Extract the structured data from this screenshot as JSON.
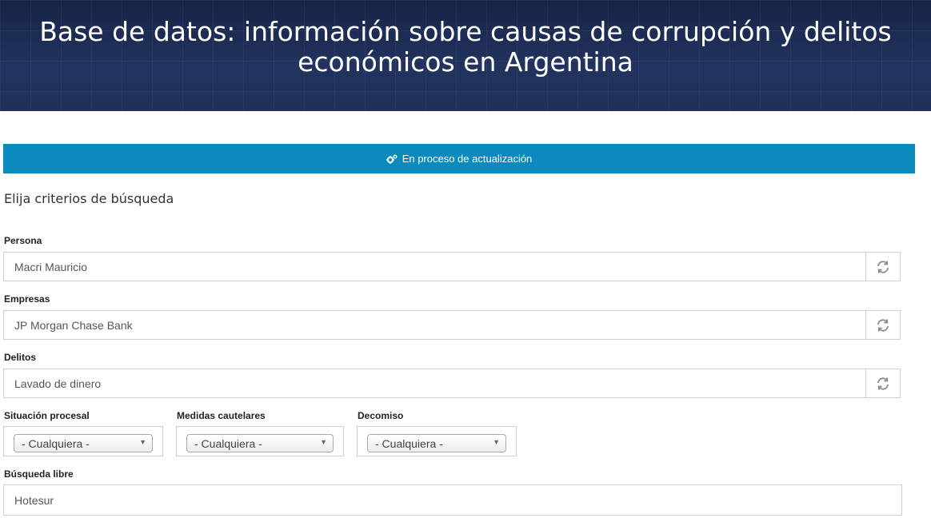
{
  "header": {
    "title_line1": "Base de datos: información sobre causas de corrupción y delitos",
    "title_line2": "económicos en Argentina"
  },
  "notice": {
    "icon": "gears-icon",
    "text": "En proceso de actualización"
  },
  "form": {
    "heading": "Elija criterios de búsqueda",
    "persona": {
      "label": "Persona",
      "value": "Macri Mauricio"
    },
    "empresas": {
      "label": "Empresas",
      "value": "JP Morgan Chase Bank"
    },
    "delitos": {
      "label": "Delitos",
      "value": "Lavado de dinero"
    },
    "situacion": {
      "label": "Situación procesal",
      "selected": "- Cualquiera -"
    },
    "medidas": {
      "label": "Medidas cautelares",
      "selected": "- Cualquiera -"
    },
    "decomiso": {
      "label": "Decomiso",
      "selected": "- Cualquiera -"
    },
    "busqueda": {
      "label": "Búsqueda libre",
      "value": "Hotesur"
    }
  },
  "colors": {
    "banner": "#1d2d55",
    "notice": "#0a8abd"
  }
}
